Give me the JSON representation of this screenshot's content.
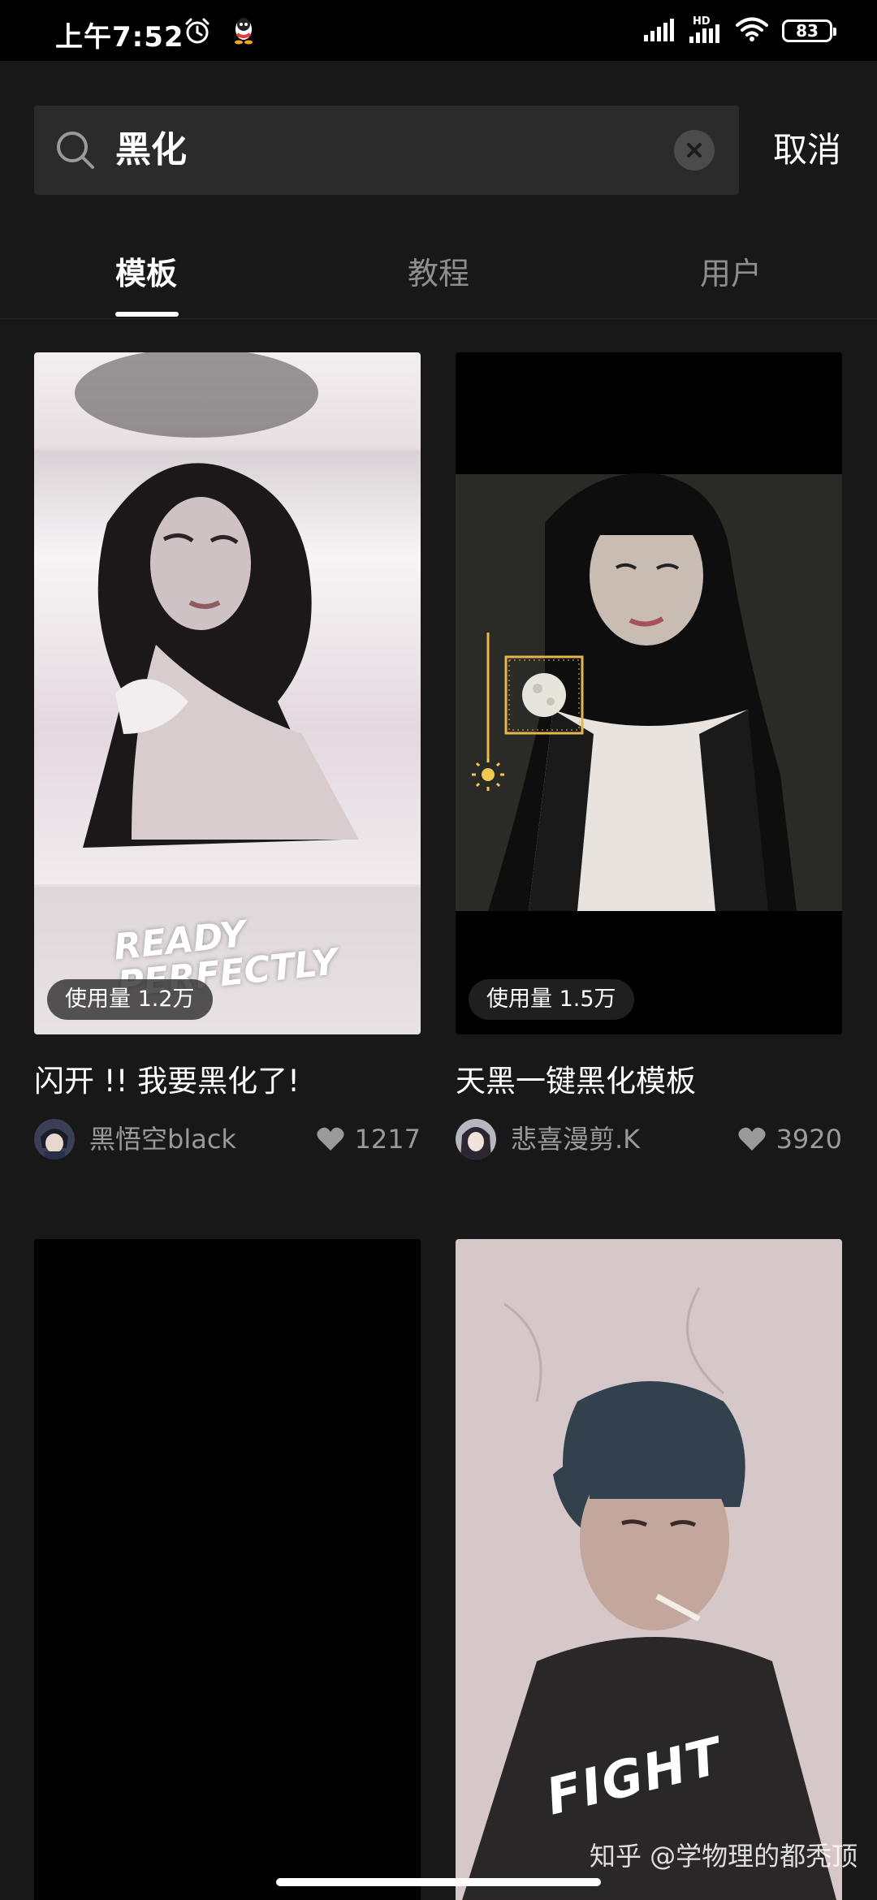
{
  "status_bar": {
    "time": "上午7:52",
    "battery": "83",
    "hd": "HD",
    "icons": [
      "alarm-clock-icon",
      "qq-penguin-icon",
      "signal-icon",
      "signal-hd-icon",
      "wifi-icon",
      "battery-icon"
    ]
  },
  "search": {
    "value": "黑化",
    "cancel_label": "取消"
  },
  "tabs": [
    {
      "label": "模板",
      "active": true
    },
    {
      "label": "教程",
      "active": false
    },
    {
      "label": "用户",
      "active": false
    }
  ],
  "cards": [
    {
      "title": "闪开 !! 我要黑化了!",
      "usage": "使用量 1.2万",
      "author": "黑悟空black",
      "likes": "1217",
      "thumb_text": "READY PERFECTLY"
    },
    {
      "title": "天黑一键黑化模板",
      "usage": "使用量 1.5万",
      "author": "悲喜漫剪.K",
      "likes": "3920"
    },
    {
      "title": "",
      "usage": "",
      "author": "",
      "likes": ""
    },
    {
      "title": "",
      "usage": "",
      "author": "",
      "likes": "",
      "thumb_text": "FIGHT"
    }
  ],
  "watermark": "知乎 @学物理的都秃顶"
}
